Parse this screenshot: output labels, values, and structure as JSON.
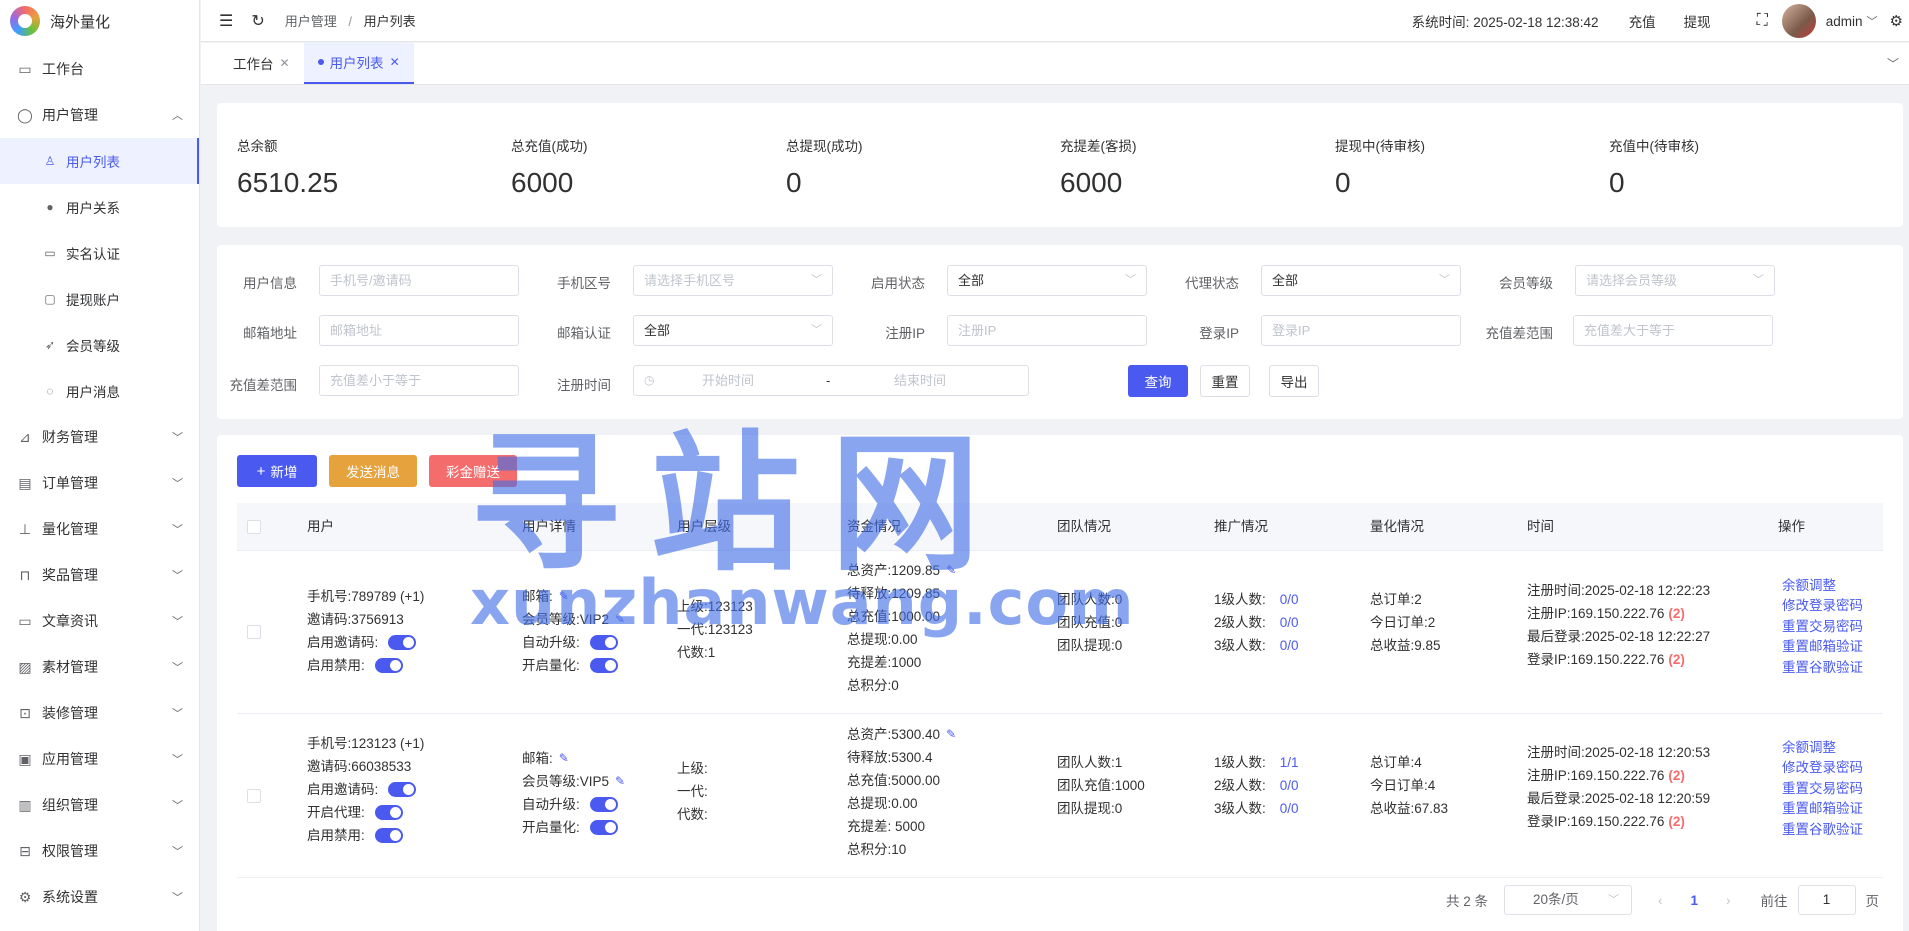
{
  "app": {
    "title": "海外量化"
  },
  "sidebar": {
    "items": [
      {
        "label": "工作台",
        "icon": "monitor-icon"
      },
      {
        "label": "用户管理",
        "icon": "user-icon",
        "expanded": true
      },
      {
        "label": "财务管理",
        "icon": "chart-icon"
      },
      {
        "label": "订单管理",
        "icon": "doc-icon"
      },
      {
        "label": "量化管理",
        "icon": "tool-icon"
      },
      {
        "label": "奖品管理",
        "icon": "bag-icon"
      },
      {
        "label": "文章资讯",
        "icon": "article-icon"
      },
      {
        "label": "素材管理",
        "icon": "image-icon"
      },
      {
        "label": "装修管理",
        "icon": "decor-icon"
      },
      {
        "label": "应用管理",
        "icon": "app-icon"
      },
      {
        "label": "组织管理",
        "icon": "org-icon"
      },
      {
        "label": "权限管理",
        "icon": "lock-icon"
      },
      {
        "label": "系统设置",
        "icon": "gear-icon"
      }
    ],
    "sub_items": [
      {
        "label": "用户列表",
        "icon": "user-outline-icon",
        "active": true
      },
      {
        "label": "用户关系",
        "icon": "users-icon"
      },
      {
        "label": "实名认证",
        "icon": "id-card-icon"
      },
      {
        "label": "提现账户",
        "icon": "folder-icon"
      },
      {
        "label": "会员等级",
        "icon": "rocket-icon"
      },
      {
        "label": "用户消息",
        "icon": "chat-icon"
      }
    ]
  },
  "header": {
    "breadcrumb": [
      "用户管理",
      "/",
      "用户列表"
    ],
    "system_time_label": "系统时间:",
    "system_time": "2025-02-18 12:38:42",
    "recharge": "充值",
    "withdraw": "提现",
    "user": "admin"
  },
  "tabs": [
    {
      "label": "工作台"
    },
    {
      "label": "用户列表",
      "active": true
    }
  ],
  "stats": [
    {
      "label": "总余额",
      "value": "6510.25"
    },
    {
      "label": "总充值(成功)",
      "value": "6000"
    },
    {
      "label": "总提现(成功)",
      "value": "0"
    },
    {
      "label": "充提差(客损)",
      "value": "6000"
    },
    {
      "label": "提现中(待审核)",
      "value": "0"
    },
    {
      "label": "充值中(待审核)",
      "value": "0"
    }
  ],
  "filters": {
    "user_info": {
      "label": "用户信息",
      "placeholder": "手机号/邀请码"
    },
    "phone_area": {
      "label": "手机区号",
      "placeholder": "请选择手机区号"
    },
    "enable_status": {
      "label": "启用状态",
      "value": "全部"
    },
    "agent_status": {
      "label": "代理状态",
      "value": "全部"
    },
    "member_level": {
      "label": "会员等级",
      "placeholder": "请选择会员等级"
    },
    "email": {
      "label": "邮箱地址",
      "placeholder": "邮箱地址"
    },
    "email_verify": {
      "label": "邮箱认证",
      "value": "全部"
    },
    "reg_ip": {
      "label": "注册IP",
      "placeholder": "注册IP"
    },
    "login_ip": {
      "label": "登录IP",
      "placeholder": "登录IP"
    },
    "diff_min": {
      "label": "充值差范围",
      "placeholder": "充值差大于等于"
    },
    "diff_max": {
      "label": "充值差范围",
      "placeholder": "充值差小于等于"
    },
    "reg_time": {
      "label": "注册时间",
      "start": "开始时间",
      "sep": "-",
      "end": "结束时间"
    },
    "query": "查询",
    "reset": "重置",
    "export": "导出"
  },
  "toolbar": {
    "add": "新增",
    "send_msg": "发送消息",
    "bonus": "彩金赠送",
    "colors": {
      "add": "#4a5af0",
      "send_msg": "#e6a23c",
      "bonus": "#f56c6c"
    }
  },
  "table": {
    "headers": [
      "用户",
      "用户详情",
      "用户层级",
      "资金情况",
      "团队情况",
      "推广情况",
      "量化情况",
      "时间",
      "操作"
    ],
    "rows": [
      {
        "user": {
          "phone": "手机号:789789 (+1)",
          "invite": "邀请码:3756913",
          "invite_enable": "启用邀请码:",
          "agent": "",
          "enable": "启用禁用:"
        },
        "detail": {
          "email": "邮箱:",
          "level": "会员等级:VIP2",
          "auto_upgrade": "自动升级:",
          "quant": "开启量化:"
        },
        "hierarchy": {
          "parent": "上级:123123",
          "gen1": "一代:123123",
          "gen_count": "代数:1"
        },
        "funds": {
          "total": "总资产:1209.85",
          "pending": "待释放:1209.85",
          "recharge": "总充值:1000.00",
          "withdraw": "总提现:0.00",
          "diff": "充提差:1000",
          "points": "总积分:0"
        },
        "team": {
          "count": "团队人数:0",
          "recharge": "团队充值:0",
          "withdraw": "团队提现:0"
        },
        "promo": [
          {
            "label": "1级人数:",
            "value": "0/0"
          },
          {
            "label": "2级人数:",
            "value": "0/0"
          },
          {
            "label": "3级人数:",
            "value": "0/0"
          }
        ],
        "quant": {
          "orders": "总订单:2",
          "today": "今日订单:2",
          "profit": "总收益:9.85"
        },
        "time": {
          "reg_time": "注册时间:2025-02-18 12:22:23",
          "reg_ip": "注册IP:169.150.222.76",
          "reg_ip_count": "(2)",
          "last_login": "最后登录:2025-02-18 12:22:27",
          "login_ip": "登录IP:169.150.222.76",
          "login_ip_count": "(2)"
        },
        "ops": [
          "余额调整",
          "修改登录密码",
          "重置交易密码",
          "重置邮箱验证",
          "重置谷歌验证"
        ]
      },
      {
        "user": {
          "phone": "手机号:123123 (+1)",
          "invite": "邀请码:66038533",
          "invite_enable": "启用邀请码:",
          "agent": "开启代理:",
          "enable": "启用禁用:"
        },
        "detail": {
          "email": "邮箱:",
          "level": "会员等级:VIP5",
          "auto_upgrade": "自动升级:",
          "quant": "开启量化:"
        },
        "hierarchy": {
          "parent": "上级:",
          "gen1": "一代:",
          "gen_count": "代数:"
        },
        "funds": {
          "total": "总资产:5300.40",
          "pending": "待释放:5300.4",
          "recharge": "总充值:5000.00",
          "withdraw": "总提现:0.00",
          "diff": "充提差: 5000",
          "points": "总积分:10"
        },
        "team": {
          "count": "团队人数:1",
          "recharge": "团队充值:1000",
          "withdraw": "团队提现:0"
        },
        "promo": [
          {
            "label": "1级人数:",
            "value": "1/1"
          },
          {
            "label": "2级人数:",
            "value": "0/0"
          },
          {
            "label": "3级人数:",
            "value": "0/0"
          }
        ],
        "quant": {
          "orders": "总订单:4",
          "today": "今日订单:4",
          "profit": "总收益:67.83"
        },
        "time": {
          "reg_time": "注册时间:2025-02-18 12:20:53",
          "reg_ip": "注册IP:169.150.222.76",
          "reg_ip_count": "(2)",
          "last_login": "最后登录:2025-02-18 12:20:59",
          "login_ip": "登录IP:169.150.222.76",
          "login_ip_count": "(2)"
        },
        "ops": [
          "余额调整",
          "修改登录密码",
          "重置交易密码",
          "重置邮箱验证",
          "重置谷歌验证"
        ]
      }
    ]
  },
  "pagination": {
    "total": "共 2 条",
    "page_size": "20条/页",
    "current": "1",
    "goto_label": "前往",
    "goto_value": "1",
    "page_suffix": "页"
  },
  "watermark": {
    "cn": "寻站网",
    "en": "xunzhanwang.com"
  }
}
